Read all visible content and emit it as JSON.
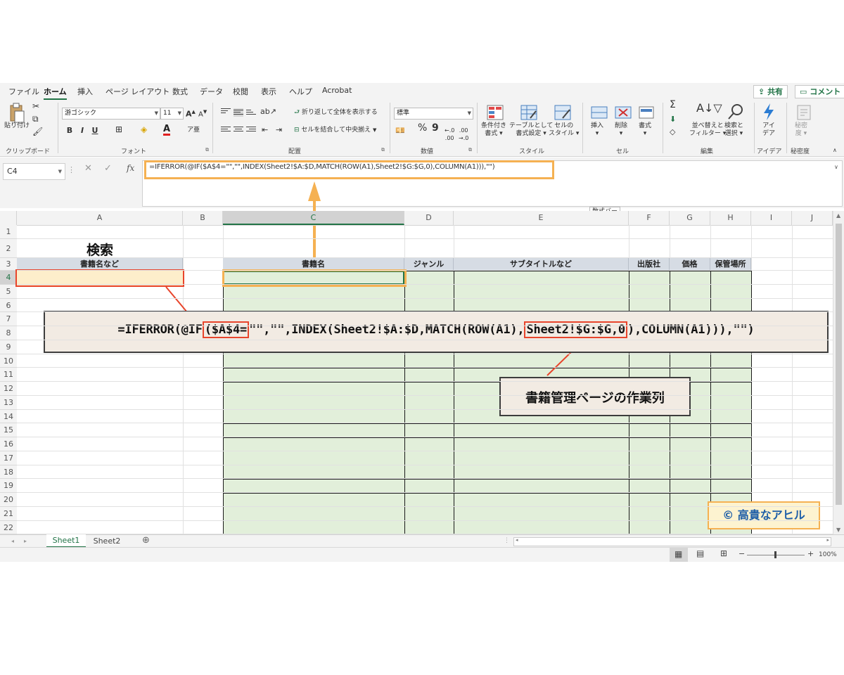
{
  "ribbon_tabs": [
    "ファイル",
    "ホーム",
    "挿入",
    "ページ レイアウト",
    "数式",
    "データ",
    "校閲",
    "表示",
    "ヘルプ",
    "Acrobat"
  ],
  "share_label": "共有",
  "comment_label": "コメント",
  "clipboard": {
    "paste": "貼り付け",
    "label": "クリップボード"
  },
  "font": {
    "name": "游ゴシック",
    "size": "11",
    "bold": "B",
    "italic": "I",
    "underline": "U",
    "label": "フォント"
  },
  "alignment": {
    "wrap": "折り返して全体を表示する",
    "merge": "セルを結合して中央揃え",
    "label": "配置"
  },
  "number": {
    "format": "標準",
    "percent": "%",
    "comma": "9",
    "label": "数値"
  },
  "styles": {
    "cond_1": "条件付き",
    "cond_2": "書式",
    "table_1": "テーブルとして",
    "table_2": "書式設定",
    "cell_1": "セルの",
    "cell_2": "スタイル",
    "label": "スタイル"
  },
  "cells": {
    "insert": "挿入",
    "delete": "削除",
    "format": "書式",
    "label": "セル"
  },
  "editing": {
    "sum": "Σ",
    "sort_1": "並べ替えと",
    "sort_2": "フィルター",
    "find_1": "検索と",
    "find_2": "選択",
    "label": "編集"
  },
  "ideas": {
    "btn_1": "アイ",
    "btn_2": "デア",
    "label": "アイデア"
  },
  "sensitivity": {
    "btn_1": "秘密",
    "btn_2": "度",
    "label": "秘密度"
  },
  "name_box": "C4",
  "fx_label": "fx",
  "formula_bar_text": "=IFERROR(@IF($A$4=\"\",\"\",INDEX(Sheet2!$A:$D,MATCH(ROW(A1),Sheet2!$G:$G,0),COLUMN(A1))),\"\")",
  "formula_bar_tooltip": "数式バー",
  "columns": [
    "A",
    "B",
    "C",
    "D",
    "E",
    "F",
    "G",
    "H",
    "I",
    "J"
  ],
  "rows": [
    "1",
    "2",
    "3",
    "4",
    "5",
    "6",
    "7",
    "8",
    "9",
    "10",
    "11",
    "12",
    "13",
    "14",
    "15",
    "16",
    "17",
    "18",
    "19",
    "20",
    "21",
    "22"
  ],
  "cells_text": {
    "a2": "検索",
    "a3": "書籍名など",
    "c3": "書籍名",
    "d3": "ジャンル",
    "e3": "サブタイトルなど",
    "f3": "出版社",
    "g3": "価格",
    "h3": "保管場所"
  },
  "callout_formula": {
    "p1": "=IFERROR(@IF",
    "p2": "($A$4=",
    "p3": "\"\",\"\",INDEX(Sheet2!$A:$D,MATCH(ROW(A1),",
    "p4": "Sheet2!$G:$G,0",
    "p5": "),COLUMN(A1))),\"\")"
  },
  "callout_note": "書籍管理ページの作業列",
  "copyright": "© 高貴なアヒル",
  "sheets": [
    "Sheet1",
    "Sheet2"
  ],
  "zoom": "100%",
  "colors": {
    "excel_green": "#217346",
    "highlight_orange": "#f5b152",
    "callout_red": "#e8452c",
    "table_green": "#e2efda",
    "header_blue": "#d6dce4"
  }
}
